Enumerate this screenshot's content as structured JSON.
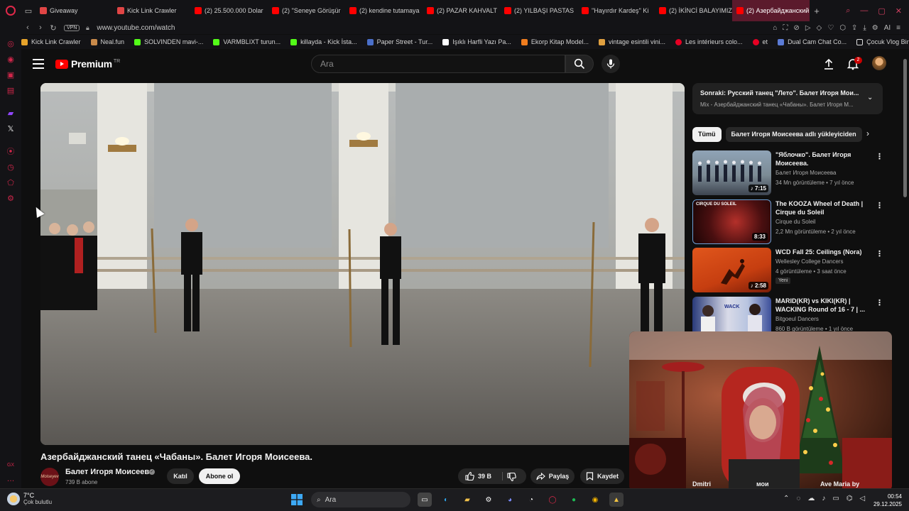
{
  "browser": {
    "tabs": [
      {
        "label": "Giveaway",
        "fav": "gift-icon",
        "active": false
      },
      {
        "label": "Kick Link Crawler",
        "fav": "gift-icon",
        "active": false
      },
      {
        "label": "(2) 25.500.000 Dolar",
        "fav": "youtube-icon",
        "active": false
      },
      {
        "label": "(2) ''Seneye Görüşür",
        "fav": "youtube-icon",
        "active": false
      },
      {
        "label": "(2) kendine tutamaya",
        "fav": "youtube-icon",
        "active": false
      },
      {
        "label": "(2) PAZAR KAHVALT",
        "fav": "youtube-icon",
        "active": false
      },
      {
        "label": "(2) YILBAŞI PASTAS",
        "fav": "youtube-icon",
        "active": false
      },
      {
        "label": "''Hayırdır Kardeş'' Ki",
        "fav": "youtube-icon",
        "active": false
      },
      {
        "label": "(2) İKİNCİ BALAYIMIZ",
        "fav": "youtube-icon",
        "active": false
      },
      {
        "label": "(2) Азербайджанский",
        "fav": "youtube-icon",
        "active": true
      }
    ],
    "vpn_label": "VPN",
    "url": "www.youtube.com/watch",
    "ai_label": "AI",
    "bookmarks": [
      {
        "label": "Kick Link Crawler",
        "color": "#e6a32a"
      },
      {
        "label": "Neal.fun",
        "color": "#c98a4a"
      },
      {
        "label": "SOLVINDEN mavi-...",
        "color": "#53fc18"
      },
      {
        "label": "VARMBLIXT turun...",
        "color": "#53fc18"
      },
      {
        "label": "killayda - Kick İsta...",
        "color": "#53fc18"
      },
      {
        "label": "Paper Street - Tur...",
        "color": "#4a6fc9"
      },
      {
        "label": "Işıklı Harfli Yazı Pa...",
        "color": "#ffffff"
      },
      {
        "label": "Ekorp Kitap Model...",
        "color": "#f07d1e"
      },
      {
        "label": "vintage esintili vini...",
        "color": "#e0a040"
      },
      {
        "label": "Les intérieurs colo...",
        "color": "#e60023"
      },
      {
        "label": "et",
        "color": "#e60023"
      },
      {
        "label": "Dual Cam Chat Co...",
        "color": "#5b7bd6"
      },
      {
        "label": "Çocuk Vlog Bingosu",
        "color": "#dddddd"
      }
    ]
  },
  "youtube": {
    "logo_text": "Premium",
    "logo_sup": "TR",
    "search_placeholder": "Ara",
    "notification_count": "2",
    "video_title": "Азербайджанский танец «Чабаны». Балет Игоря Моисеева.",
    "channel_name": "Балет Игоря Моисеева",
    "channel_avatar_text": "Moiseyev",
    "subscribers": "739 B abone",
    "join_label": "Katıl",
    "subscribe_label": "Abone ol",
    "likes": "39 B",
    "share_label": "Paylaş",
    "save_label": "Kaydet",
    "next_up_title": "Sonraki: Русский танец \"Лето\". Балет Игоря Мои...",
    "next_up_sub": "Mix - Азербайджанский танец «Чабаны». Балет Игоря М...",
    "chips": [
      "Tümü",
      "Балет Игоря Моисеева adlı yükleyiciden"
    ],
    "recommendations": [
      {
        "title": "\"Яблочко\". Балет Игоря Моисеева.",
        "channel": "Балет Игоря Моисеева",
        "views": "34 Mn görüntüleme • 7 yıl önce",
        "duration": "♪ 7:15",
        "new": ""
      },
      {
        "title": "The KOOZA Wheel of Death | Cirque du Soleil",
        "channel": "Cirque du Soleil",
        "views": "2,2 Mn görüntüleme • 2 yıl önce",
        "duration": "8:33",
        "new": "",
        "thumb_label": "CIRQUE DU SOLEIL"
      },
      {
        "title": "WCD Fall 25: Ceilings (Nora)",
        "channel": "Wellesley College Dancers",
        "views": "4 görüntüleme • 3 saat önce",
        "duration": "♪ 2:58",
        "new": "Yeni"
      },
      {
        "title": "MARID(KR) vs KIKI(KR) | WACKING Round of 16 - 7 | ...",
        "channel": "Bitgoeul Dancers",
        "views": "860 B görüntüleme • 1 yıl önce",
        "duration": "",
        "new": ""
      }
    ],
    "bottom_labels": [
      "Dmitri",
      "мои",
      "Ave Maria by"
    ]
  },
  "taskbar": {
    "temperature": "7°C",
    "weather": "Çok bulutlu",
    "search_placeholder": "Ara",
    "time": "00:54",
    "date": "29.12.2025"
  },
  "colors": {
    "accent": "#ff0000",
    "opera": "#d0264a",
    "background": "#0f0f0f"
  }
}
